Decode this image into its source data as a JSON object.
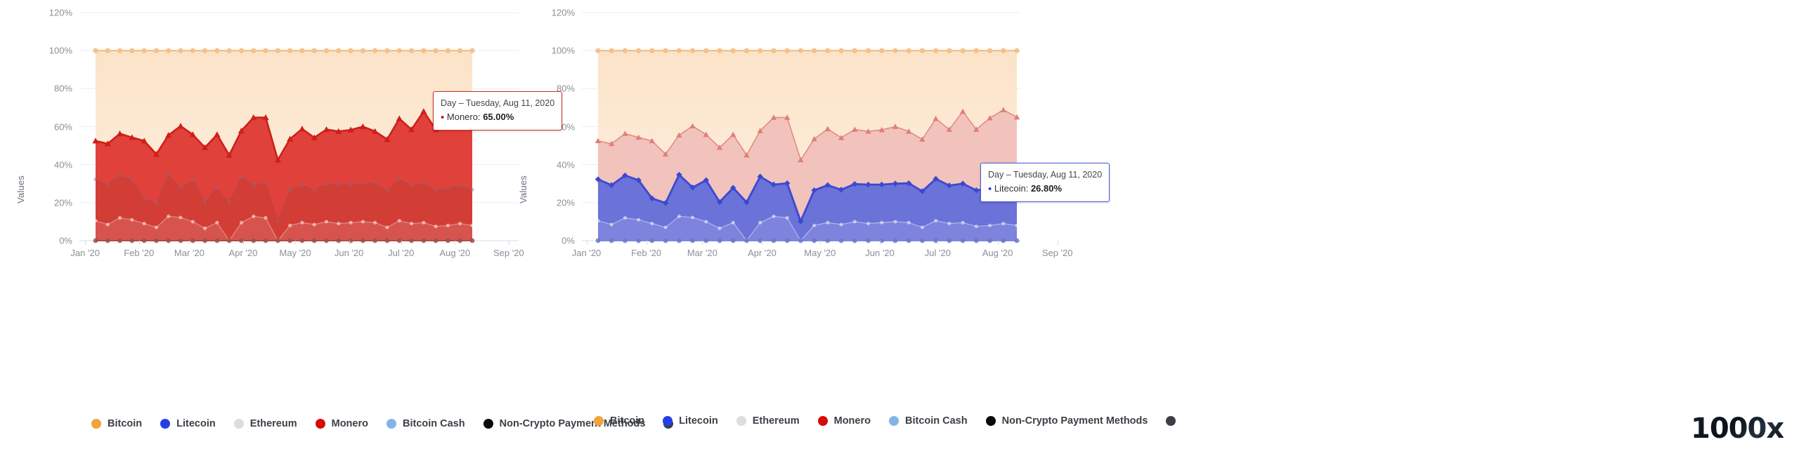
{
  "watermark": "1000x",
  "axis": {
    "y_title": "Values",
    "y_ticks": [
      "120%",
      "100%",
      "80%",
      "60%",
      "40%",
      "20%",
      "0%"
    ],
    "y_values": [
      120,
      100,
      80,
      60,
      40,
      20,
      0
    ],
    "x_ticks": [
      "Jan '20",
      "Feb '20",
      "Mar '20",
      "Apr '20",
      "May '20",
      "Jun '20",
      "Jul '20",
      "Aug '20",
      "Sep '20"
    ]
  },
  "legend": {
    "items": [
      {
        "label": "Bitcoin",
        "color": "#f2a33c"
      },
      {
        "label": "Litecoin",
        "color": "#2340e8"
      },
      {
        "label": "Ethereum",
        "color": "#dcdde0"
      },
      {
        "label": "Monero",
        "color": "#d80a0a"
      },
      {
        "label": "Bitcoin Cash",
        "color": "#82b4e8"
      },
      {
        "label": "Non-Crypto Payment Methods",
        "color": "#0a0a0a"
      },
      {
        "label": "",
        "color": "#3c3f46"
      }
    ]
  },
  "colors": {
    "bitcoin": "#f2a33c",
    "bitcoin_area": "#fceedd",
    "litecoin": "#2340e8",
    "litecoin_active": "#6b72d8",
    "litecoin_line_active": "#3b49d1",
    "ethereum": "#dcdde0",
    "monero": "#d80a0a",
    "monero_active": "#e0413a",
    "monero_line_active": "#cf1f18",
    "monero_muted": "#f2c3bc",
    "monero_muted_line": "#e08b82",
    "bitcoin_cash": "#82b4e8",
    "gridline": "#eceef1",
    "tick_text": "#8a8f98"
  },
  "left_panel": {
    "highlight_series": "Monero",
    "tooltip": {
      "head": "Day – Tuesday, Aug 11, 2020",
      "bullet": "•",
      "series": "Monero",
      "value": "65.00%",
      "border_color": "#c9322b",
      "bullet_color": "#d80a0a"
    }
  },
  "right_panel": {
    "highlight_series": "Litecoin",
    "tooltip": {
      "head": "Day – Tuesday, Aug 11, 2020",
      "bullet": "•",
      "series": "Litecoin",
      "value": "26.80%",
      "border_color": "#4758d8",
      "bullet_color": "#2340e8"
    }
  },
  "chart_data": {
    "type": "area",
    "title": "",
    "subtitle": "",
    "xlabel": "",
    "ylabel": "Values",
    "ylim": [
      0,
      120
    ],
    "grid": true,
    "legend_position": "bottom",
    "stacked_percent": true,
    "x_tick_labels": [
      "Jan '20",
      "Feb '20",
      "Mar '20",
      "Apr '20",
      "May '20",
      "Jun '20",
      "Jul '20",
      "Aug '20",
      "Sep '20"
    ],
    "x_range": [
      "Jan '20",
      "Sep '20"
    ],
    "data_start": "Jan 07, 2020",
    "data_end": "Aug 11, 2020",
    "n_points": 32,
    "highlighted_point": {
      "date": "Tuesday, Aug 11, 2020",
      "Monero": 65.0,
      "Litecoin": 26.8
    },
    "series": [
      {
        "name": "Bitcoin",
        "color": "#f2a33c",
        "values": [
          100,
          100,
          100,
          100,
          100,
          100,
          100,
          100,
          100,
          100,
          100,
          100,
          100,
          100,
          100,
          100,
          100,
          100,
          100,
          100,
          100,
          100,
          100,
          100,
          100,
          100,
          100,
          100,
          100,
          100,
          100,
          100
        ]
      },
      {
        "name": "Monero",
        "color": "#d80a0a",
        "values": [
          52.5,
          51.0,
          56.3,
          54.3,
          52.5,
          45.5,
          55.5,
          60.3,
          55.8,
          49.0,
          55.8,
          45.0,
          57.8,
          64.8,
          64.8,
          42.5,
          53.5,
          58.8,
          54.2,
          58.5,
          57.5,
          58.3,
          60.0,
          57.5,
          53.3,
          64.2,
          58.5,
          68.0,
          58.5,
          64.5,
          68.8,
          65.0
        ]
      },
      {
        "name": "Litecoin",
        "color": "#2340e8",
        "values": [
          32.3,
          29.2,
          34.3,
          31.8,
          22.2,
          19.8,
          34.7,
          28.0,
          31.8,
          20.3,
          27.8,
          20.2,
          33.7,
          29.5,
          30.2,
          10.2,
          26.5,
          29.2,
          26.8,
          29.8,
          29.5,
          29.5,
          30.0,
          30.2,
          26.0,
          32.5,
          29.0,
          30.0,
          26.5,
          27.5,
          29.0,
          26.8
        ]
      },
      {
        "name": "Ethereum",
        "color": "#dcdde0",
        "values": [
          10.5,
          8.5,
          12.0,
          11.0,
          9.0,
          7.0,
          12.8,
          12.2,
          10.0,
          6.5,
          9.5,
          0.0,
          9.5,
          12.8,
          12.0,
          0.0,
          8.0,
          9.5,
          8.5,
          10.0,
          9.0,
          9.5,
          10.0,
          9.5,
          7.0,
          10.5,
          9.0,
          9.5,
          7.5,
          8.0,
          9.0,
          8.0
        ]
      },
      {
        "name": "Bitcoin Cash",
        "color": "#82b4e8",
        "values": [
          0,
          0,
          0,
          0,
          0,
          0,
          0,
          0,
          0,
          0,
          0,
          0,
          0,
          0,
          0,
          0,
          0,
          0,
          0,
          0,
          0,
          0,
          0,
          0,
          0,
          0,
          0,
          0,
          0,
          0,
          0,
          0
        ]
      },
      {
        "name": "Non-Crypto Payment Methods",
        "color": "#0a0a0a",
        "values": [
          0,
          0,
          0,
          0,
          0,
          0,
          0,
          0,
          0,
          0,
          0,
          0,
          0,
          0,
          0,
          0,
          0,
          0,
          0,
          0,
          0,
          0,
          0,
          0,
          0,
          0,
          0,
          0,
          0,
          0,
          0,
          0
        ]
      }
    ]
  }
}
